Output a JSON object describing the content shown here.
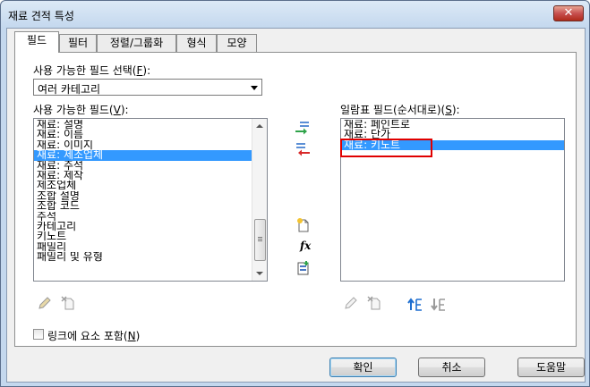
{
  "window": {
    "title": "재료 견적 특성",
    "close_glyph": "✕"
  },
  "tabs": [
    {
      "label": "필드",
      "active": true
    },
    {
      "label": "필터",
      "active": false
    },
    {
      "label": "정렬/그룹화",
      "active": false
    },
    {
      "label": "형식",
      "active": false
    },
    {
      "label": "모양",
      "active": false
    }
  ],
  "fields": {
    "select_label": "사용 가능한 필드 선택(",
    "select_key": "F",
    "select_suffix": "):",
    "select_value": "여러 카테고리",
    "available_label": "사용 가능한 필드(",
    "available_key": "V",
    "available_suffix": "):",
    "available_items": [
      "재료: 설명",
      "재료: 이름",
      "재료: 이미지",
      "재료: 제조업체",
      "재료: 주석",
      "재료: 제작",
      "제조업체",
      "조합 설명",
      "조합 코드",
      "주석",
      "카테고리",
      "키노트",
      "패밀리",
      "패밀리 및 유형"
    ],
    "available_selected_index": 3,
    "schedule_label": "일람표 필드(순서대로)(",
    "schedule_key": "S",
    "schedule_suffix": "):",
    "schedule_items": [
      "재료: 페인트로",
      "재료: 단가",
      "재료: 키노트"
    ],
    "schedule_selected_index": 2,
    "include_links_label": "링크에 요소 포함(",
    "include_links_key": "N",
    "include_links_suffix": ")",
    "include_links_checked": false
  },
  "buttons": {
    "ok": "확인",
    "cancel": "취소",
    "help": "도움말"
  },
  "icons": {
    "add": "add-field-icon",
    "remove": "remove-field-icon",
    "new_parameter": "new-parameter-icon",
    "formula": "formula-icon",
    "combine": "combine-parameters-icon",
    "edit_left": "edit-pencil-icon",
    "delete_left": "delete-parameter-icon",
    "edit_right": "edit-pencil-icon",
    "delete_right": "delete-parameter-icon",
    "move_up": "move-up-icon",
    "move_down": "move-down-icon",
    "formula_glyph": "fx"
  }
}
